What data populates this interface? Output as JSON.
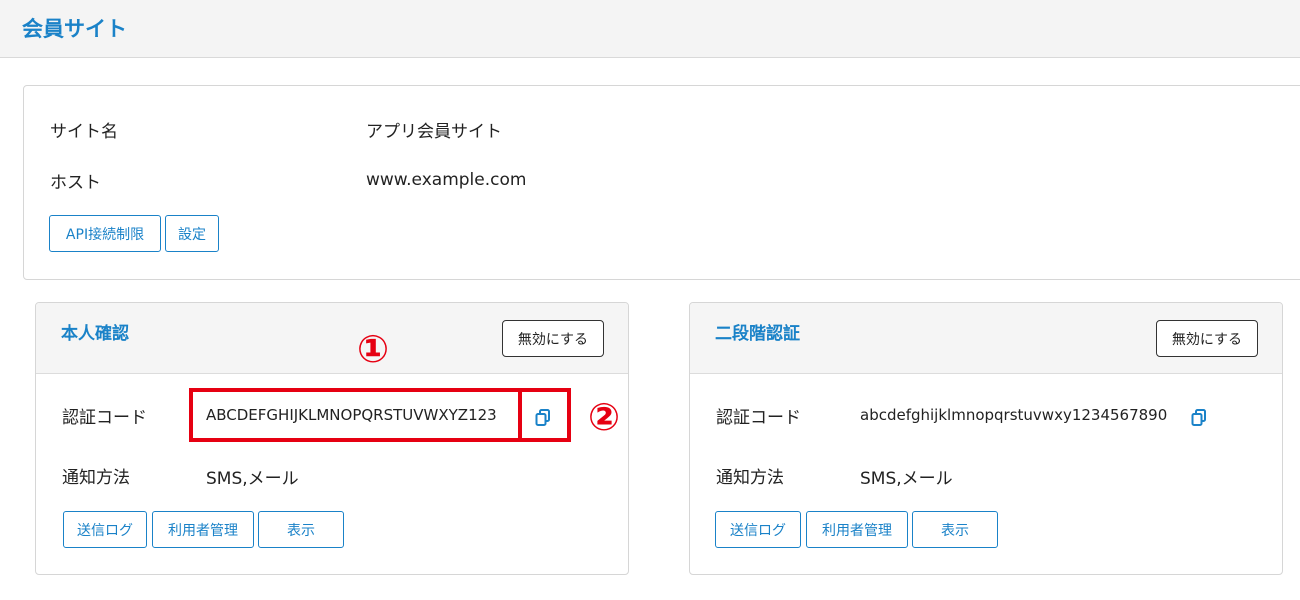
{
  "header": {
    "title": "会員サイト"
  },
  "site": {
    "name_label": "サイト名",
    "name_value": "アプリ会員サイト",
    "host_label": "ホスト",
    "host_value": "www.example.com",
    "api_button": "API接続制限",
    "settings_button": "設定"
  },
  "identity_panel": {
    "title": "本人確認",
    "disable_button": "無効にする",
    "code_label": "認証コード",
    "code_value": "ABCDEFGHIJKLMNOPQRSTUVWXYZ123",
    "notify_label": "通知方法",
    "notify_value": "SMS,メール",
    "log_button": "送信ログ",
    "users_button": "利用者管理",
    "show_button": "表示"
  },
  "twofactor_panel": {
    "title": "二段階認証",
    "disable_button": "無効にする",
    "code_label": "認証コード",
    "code_value": "abcdefghijklmnopqrstuvwxy1234567890",
    "notify_label": "通知方法",
    "notify_value": "SMS,メール",
    "log_button": "送信ログ",
    "users_button": "利用者管理",
    "show_button": "表示"
  },
  "annotations": {
    "marker_1": "①",
    "marker_2": "②",
    "color": "#e60012"
  },
  "colors": {
    "accent": "#1a82c8"
  }
}
